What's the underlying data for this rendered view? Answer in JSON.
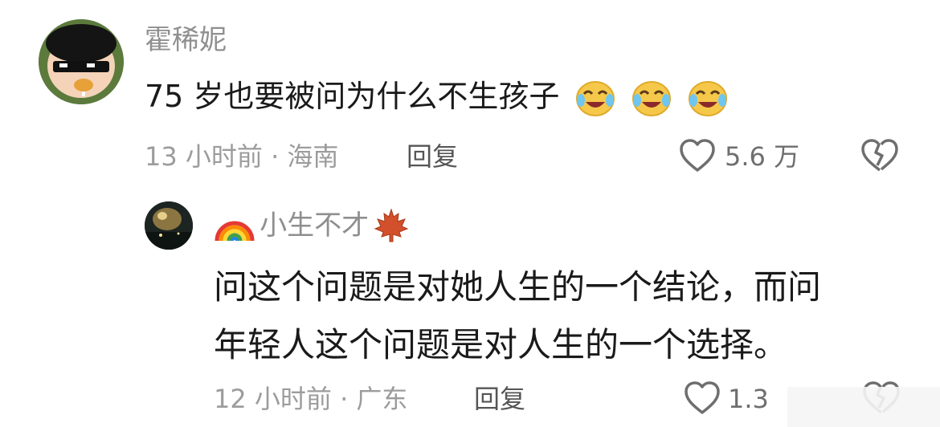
{
  "comment": {
    "username": "霍稀妮",
    "text": "75 岁也要被问为什么不生孩子",
    "emojis": [
      "crying-laughing-face-emoji",
      "crying-laughing-face-emoji",
      "crying-laughing-face-emoji"
    ],
    "meta": "13 小时前 · 海南",
    "reply_label": "回复",
    "likes": "5.6 万"
  },
  "reply": {
    "username": "小生不才",
    "username_prefix_icon": "rainbow-icon",
    "username_suffix_icon": "maple-leaf-icon",
    "line1": "问这个问题是对她人生的一个结论，而问",
    "line2": "年轻人这个问题是对人生的一个选择。",
    "meta": "12 小时前 · 广东",
    "reply_label": "回复",
    "likes": "1.3"
  },
  "colors": {
    "username": "#8f8f8f",
    "text": "#1a1a1a",
    "meta": "#9c9c9c"
  }
}
